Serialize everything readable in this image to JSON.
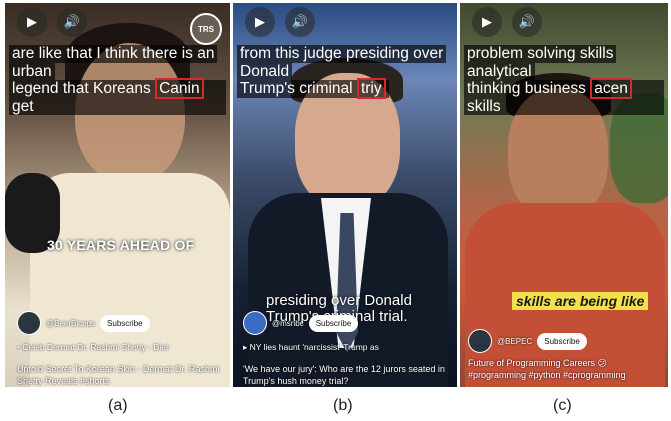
{
  "panels": [
    {
      "subtitle_lines": [
        "are like that I think there is an",
        "urban",
        "legend that Koreans "
      ],
      "highlight_word": "Canin",
      "subtitle_after": " get",
      "badge": "TRS",
      "overlay_caption": "30 YEARS AHEAD OF",
      "channel": "@BeerBiceps",
      "subscribe": "Subscribe",
      "info": "Celeb Dermat Dr. Rashmi Shetty - Diet",
      "title": "Untold Secret To Korean Skin - Dermat Dr. Rashmi Shetty Reveals #shorts",
      "label": "(a)"
    },
    {
      "subtitle_lines": [
        "from this judge presiding over",
        "Donald",
        "Trump's criminal "
      ],
      "highlight_word": "triy",
      "subtitle_after": "",
      "overlay_caption_1": "presiding over Donald",
      "overlay_caption_2": "Trump's criminal trial.",
      "channel": "@msnbc",
      "subscribe": "Subscribe",
      "info": "NY lies haunt 'narcissist' Trump as",
      "title": "'We have our jury': Who are the 12 jurors seated in Trump's hush money trial?",
      "label": "(b)"
    },
    {
      "subtitle_lines": [
        "problem solving skills",
        "analytical",
        "thinking business "
      ],
      "highlight_word": "acen",
      "subtitle_after": " skills",
      "overlay_caption": "skills are being like",
      "channel": "@BEPEC",
      "subscribe": "Subscribe",
      "title": "Future of Programming Careers 😕 #programming #python #cprogramming",
      "label": "(c)"
    }
  ],
  "icons": {
    "play": "play-icon",
    "volume": "volume-icon",
    "avatar": "channel-avatar",
    "badge": "channel-badge-icon"
  },
  "colors": {
    "highlight_border": "#d62a2a",
    "subtitle_bg": "rgba(0,0,0,0.62)",
    "caption_yellow": "#f4e04d"
  }
}
